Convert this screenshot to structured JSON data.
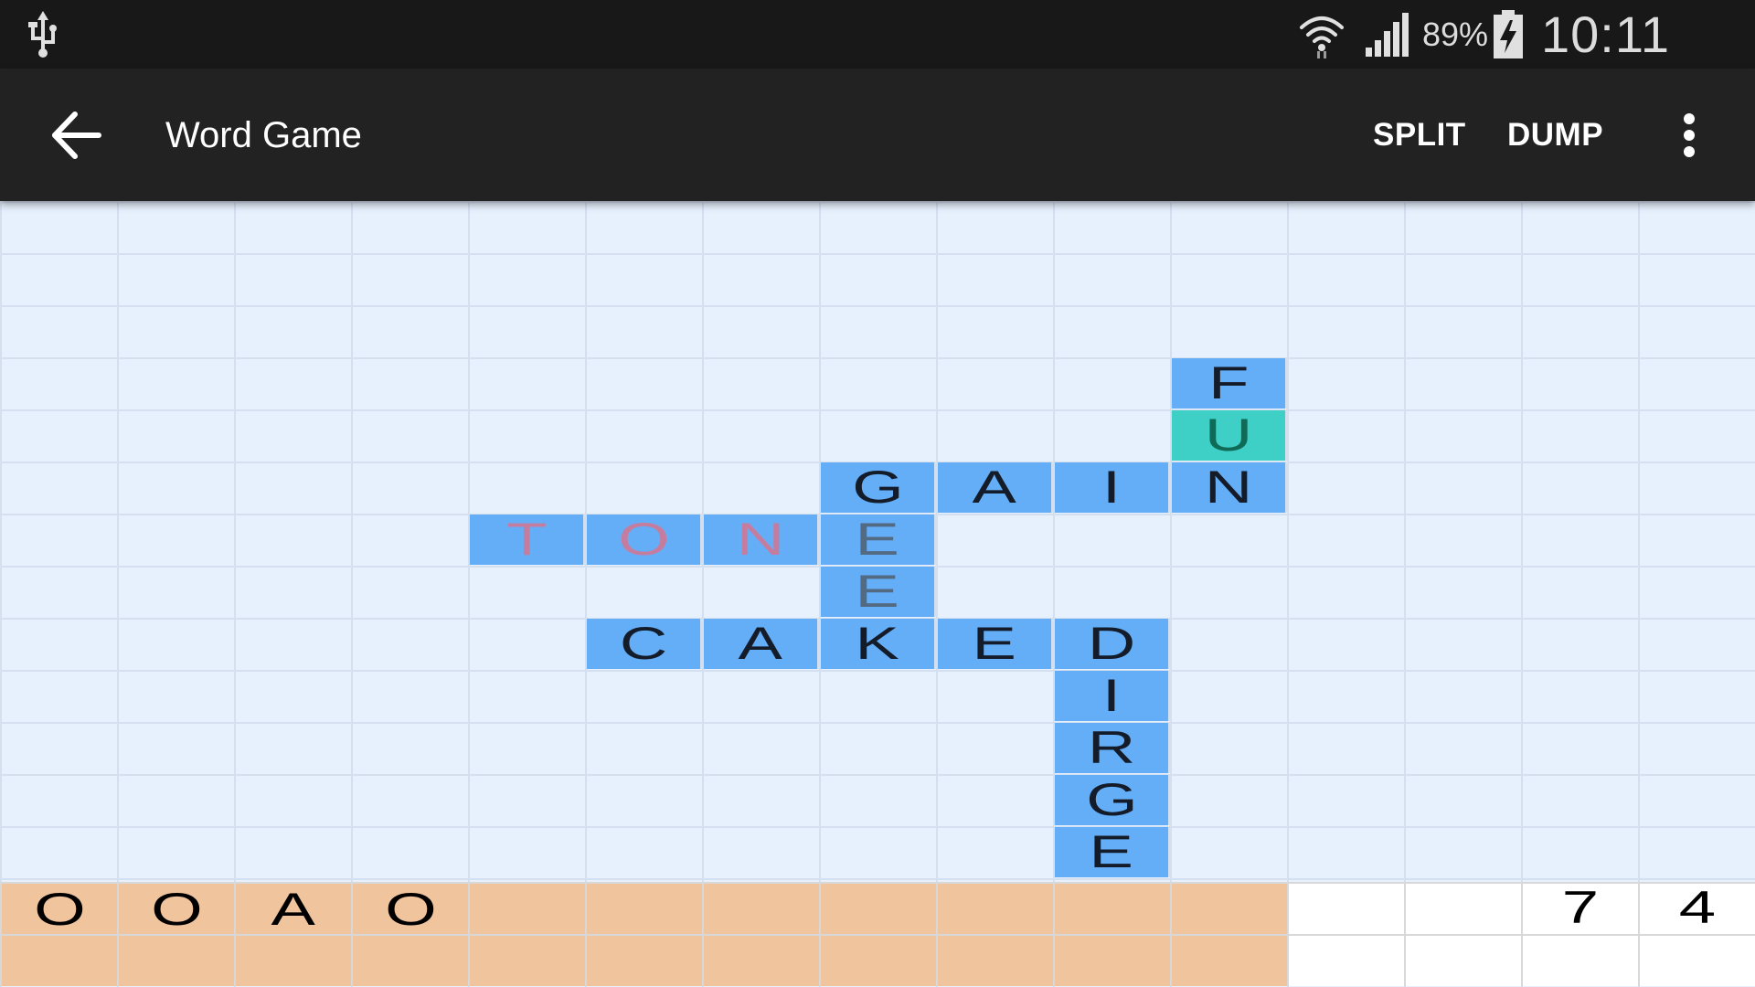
{
  "status_bar": {
    "usb_icon": "usb-icon",
    "wifi_icon": "wifi-icon",
    "signal_icon": "signal-icon",
    "battery_percent": "89%",
    "battery_icon": "battery-charging-icon",
    "time": "10:11 PM"
  },
  "app_bar": {
    "back_icon": "arrow-left-icon",
    "title": "Word Game",
    "split_label": "SPLIT",
    "dump_label": "DUMP",
    "overflow_icon": "more-vert-icon"
  },
  "board": {
    "tiles": [
      {
        "letter": "F",
        "style": "normal"
      },
      {
        "letter": "U",
        "style": "highlight"
      },
      {
        "letter": "G",
        "style": "normal"
      },
      {
        "letter": "A",
        "style": "normal"
      },
      {
        "letter": "I",
        "style": "normal"
      },
      {
        "letter": "N",
        "style": "normal"
      },
      {
        "letter": "T",
        "style": "pink"
      },
      {
        "letter": "O",
        "style": "pink"
      },
      {
        "letter": "N",
        "style": "pink"
      },
      {
        "letter": "E",
        "style": "faded"
      },
      {
        "letter": "E",
        "style": "faded"
      },
      {
        "letter": "C",
        "style": "normal"
      },
      {
        "letter": "A",
        "style": "normal"
      },
      {
        "letter": "K",
        "style": "normal"
      },
      {
        "letter": "E",
        "style": "normal"
      },
      {
        "letter": "D",
        "style": "normal"
      },
      {
        "letter": "I",
        "style": "normal"
      },
      {
        "letter": "R",
        "style": "normal"
      },
      {
        "letter": "G",
        "style": "normal"
      },
      {
        "letter": "E",
        "style": "normal"
      }
    ]
  },
  "rack": {
    "letters": [
      "O",
      "O",
      "A",
      "O"
    ]
  },
  "score": {
    "digits": [
      "7",
      "4"
    ]
  },
  "colors": {
    "board_bg": "#e7f0fd",
    "tile": "#64aef8",
    "tile_highlight": "#3ecfc6",
    "rack": "#f0c49c",
    "app_bar": "#222222",
    "status_bar": "#181818"
  }
}
